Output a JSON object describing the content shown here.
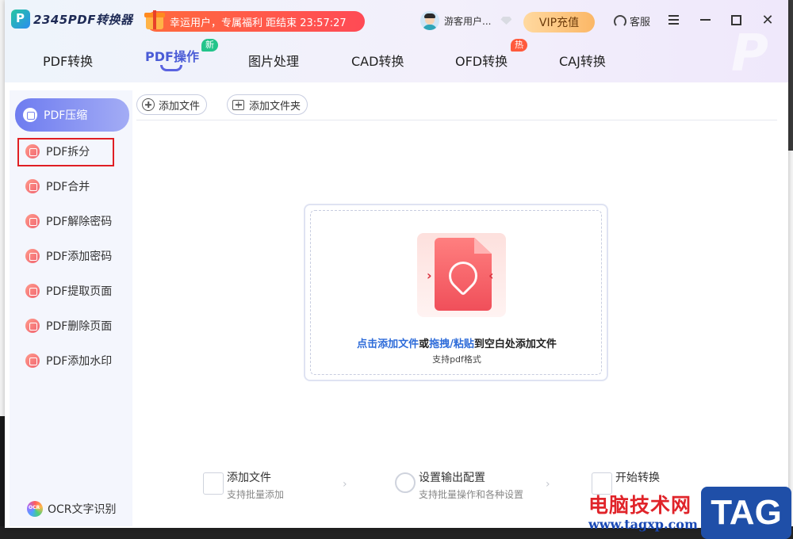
{
  "app": {
    "name": "2345PDF转换器",
    "promo_text": "幸运用户，专属福利 距结束 23:57:27",
    "user_name": "游客用户...",
    "vip_label": "VIP充值",
    "service_label": "客服"
  },
  "tabs": [
    {
      "label": "PDF转换",
      "active": false
    },
    {
      "label": "PDF操作",
      "active": true,
      "badge": "新"
    },
    {
      "label": "图片处理",
      "active": false
    },
    {
      "label": "CAD转换",
      "active": false
    },
    {
      "label": "OFD转换",
      "active": false,
      "badge": "热"
    },
    {
      "label": "CAJ转换",
      "active": false
    }
  ],
  "sidebar": {
    "items": [
      {
        "label": "PDF压缩",
        "active": true
      },
      {
        "label": "PDF拆分",
        "active": false,
        "highlighted": true
      },
      {
        "label": "PDF合并",
        "active": false
      },
      {
        "label": "PDF解除密码",
        "active": false
      },
      {
        "label": "PDF添加密码",
        "active": false
      },
      {
        "label": "PDF提取页面",
        "active": false
      },
      {
        "label": "PDF删除页面",
        "active": false
      },
      {
        "label": "PDF添加水印",
        "active": false
      }
    ],
    "ocr_label": "OCR文字识别"
  },
  "toolbar": {
    "add_file": "添加文件",
    "add_folder": "添加文件夹"
  },
  "dropzone": {
    "link1": "点击添加文件",
    "mid1": "或",
    "link2": "拖拽/粘贴",
    "tail": "到空白处添加文件",
    "sub": "支持pdf格式"
  },
  "steps": [
    {
      "title": "添加文件",
      "desc": "支持批量添加"
    },
    {
      "title": "设置输出配置",
      "desc": "支持批量操作和各种设置"
    },
    {
      "title": "开始转换",
      "desc": ""
    }
  ],
  "watermark": {
    "cn": "电脑技术网",
    "url": "www.tagxp.com",
    "tag": "TAG"
  },
  "colors": {
    "accent": "#5a63e0",
    "highlight_border": "#e01f24",
    "link": "#2d6bd9",
    "promo": "#ff5a47"
  }
}
